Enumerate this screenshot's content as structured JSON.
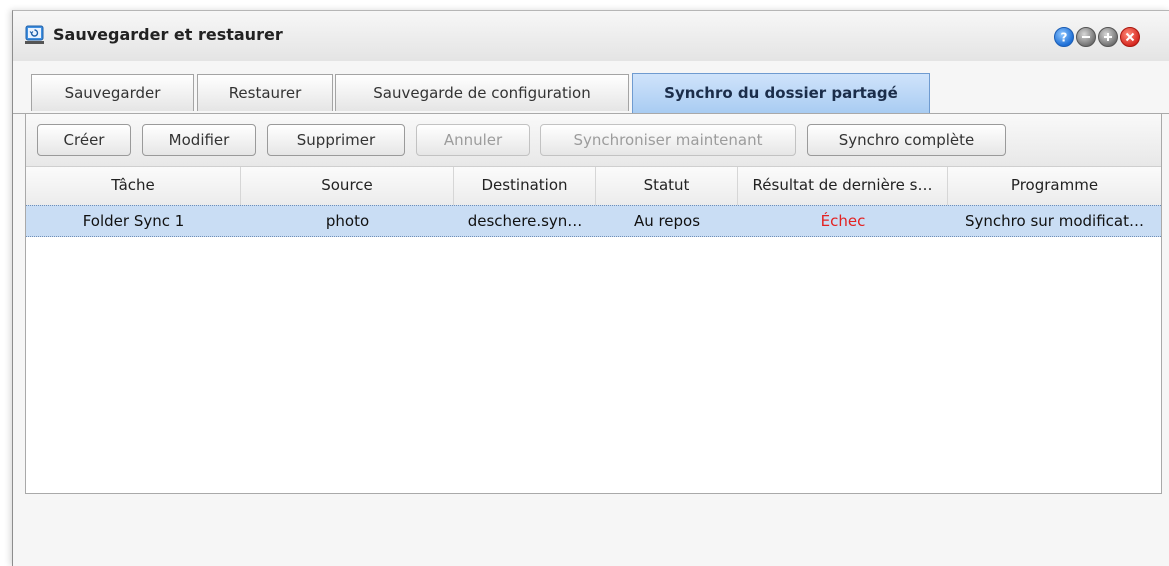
{
  "window": {
    "title": "Sauvegarder et restaurer"
  },
  "window_controls": {
    "help_icon": "help-icon",
    "minimize_icon": "minimize-icon",
    "maximize_icon": "maximize-icon",
    "close_icon": "close-icon"
  },
  "tabs": [
    {
      "label": "Sauvegarder",
      "active": false
    },
    {
      "label": "Restaurer",
      "active": false
    },
    {
      "label": "Sauvegarde de configuration",
      "active": false
    },
    {
      "label": "Synchro du dossier partagé",
      "active": true
    }
  ],
  "toolbar": {
    "create": "Créer",
    "modify": "Modifier",
    "delete": "Supprimer",
    "cancel": "Annuler",
    "sync_now": "Synchroniser maintenant",
    "full_sync": "Synchro complète"
  },
  "table": {
    "columns": [
      "Tâche",
      "Source",
      "Destination",
      "Statut",
      "Résultat de dernière s…",
      "Programme"
    ],
    "rows": [
      {
        "task": "Folder Sync 1",
        "source": "photo",
        "destination": "deschere.syn…",
        "status": "Au repos",
        "result": "Échec",
        "schedule": "Synchro sur modificat…"
      }
    ]
  },
  "colors": {
    "active_tab": "#a9ccf2",
    "selected_row": "#c9ddf4",
    "failure_text": "#e32222"
  }
}
